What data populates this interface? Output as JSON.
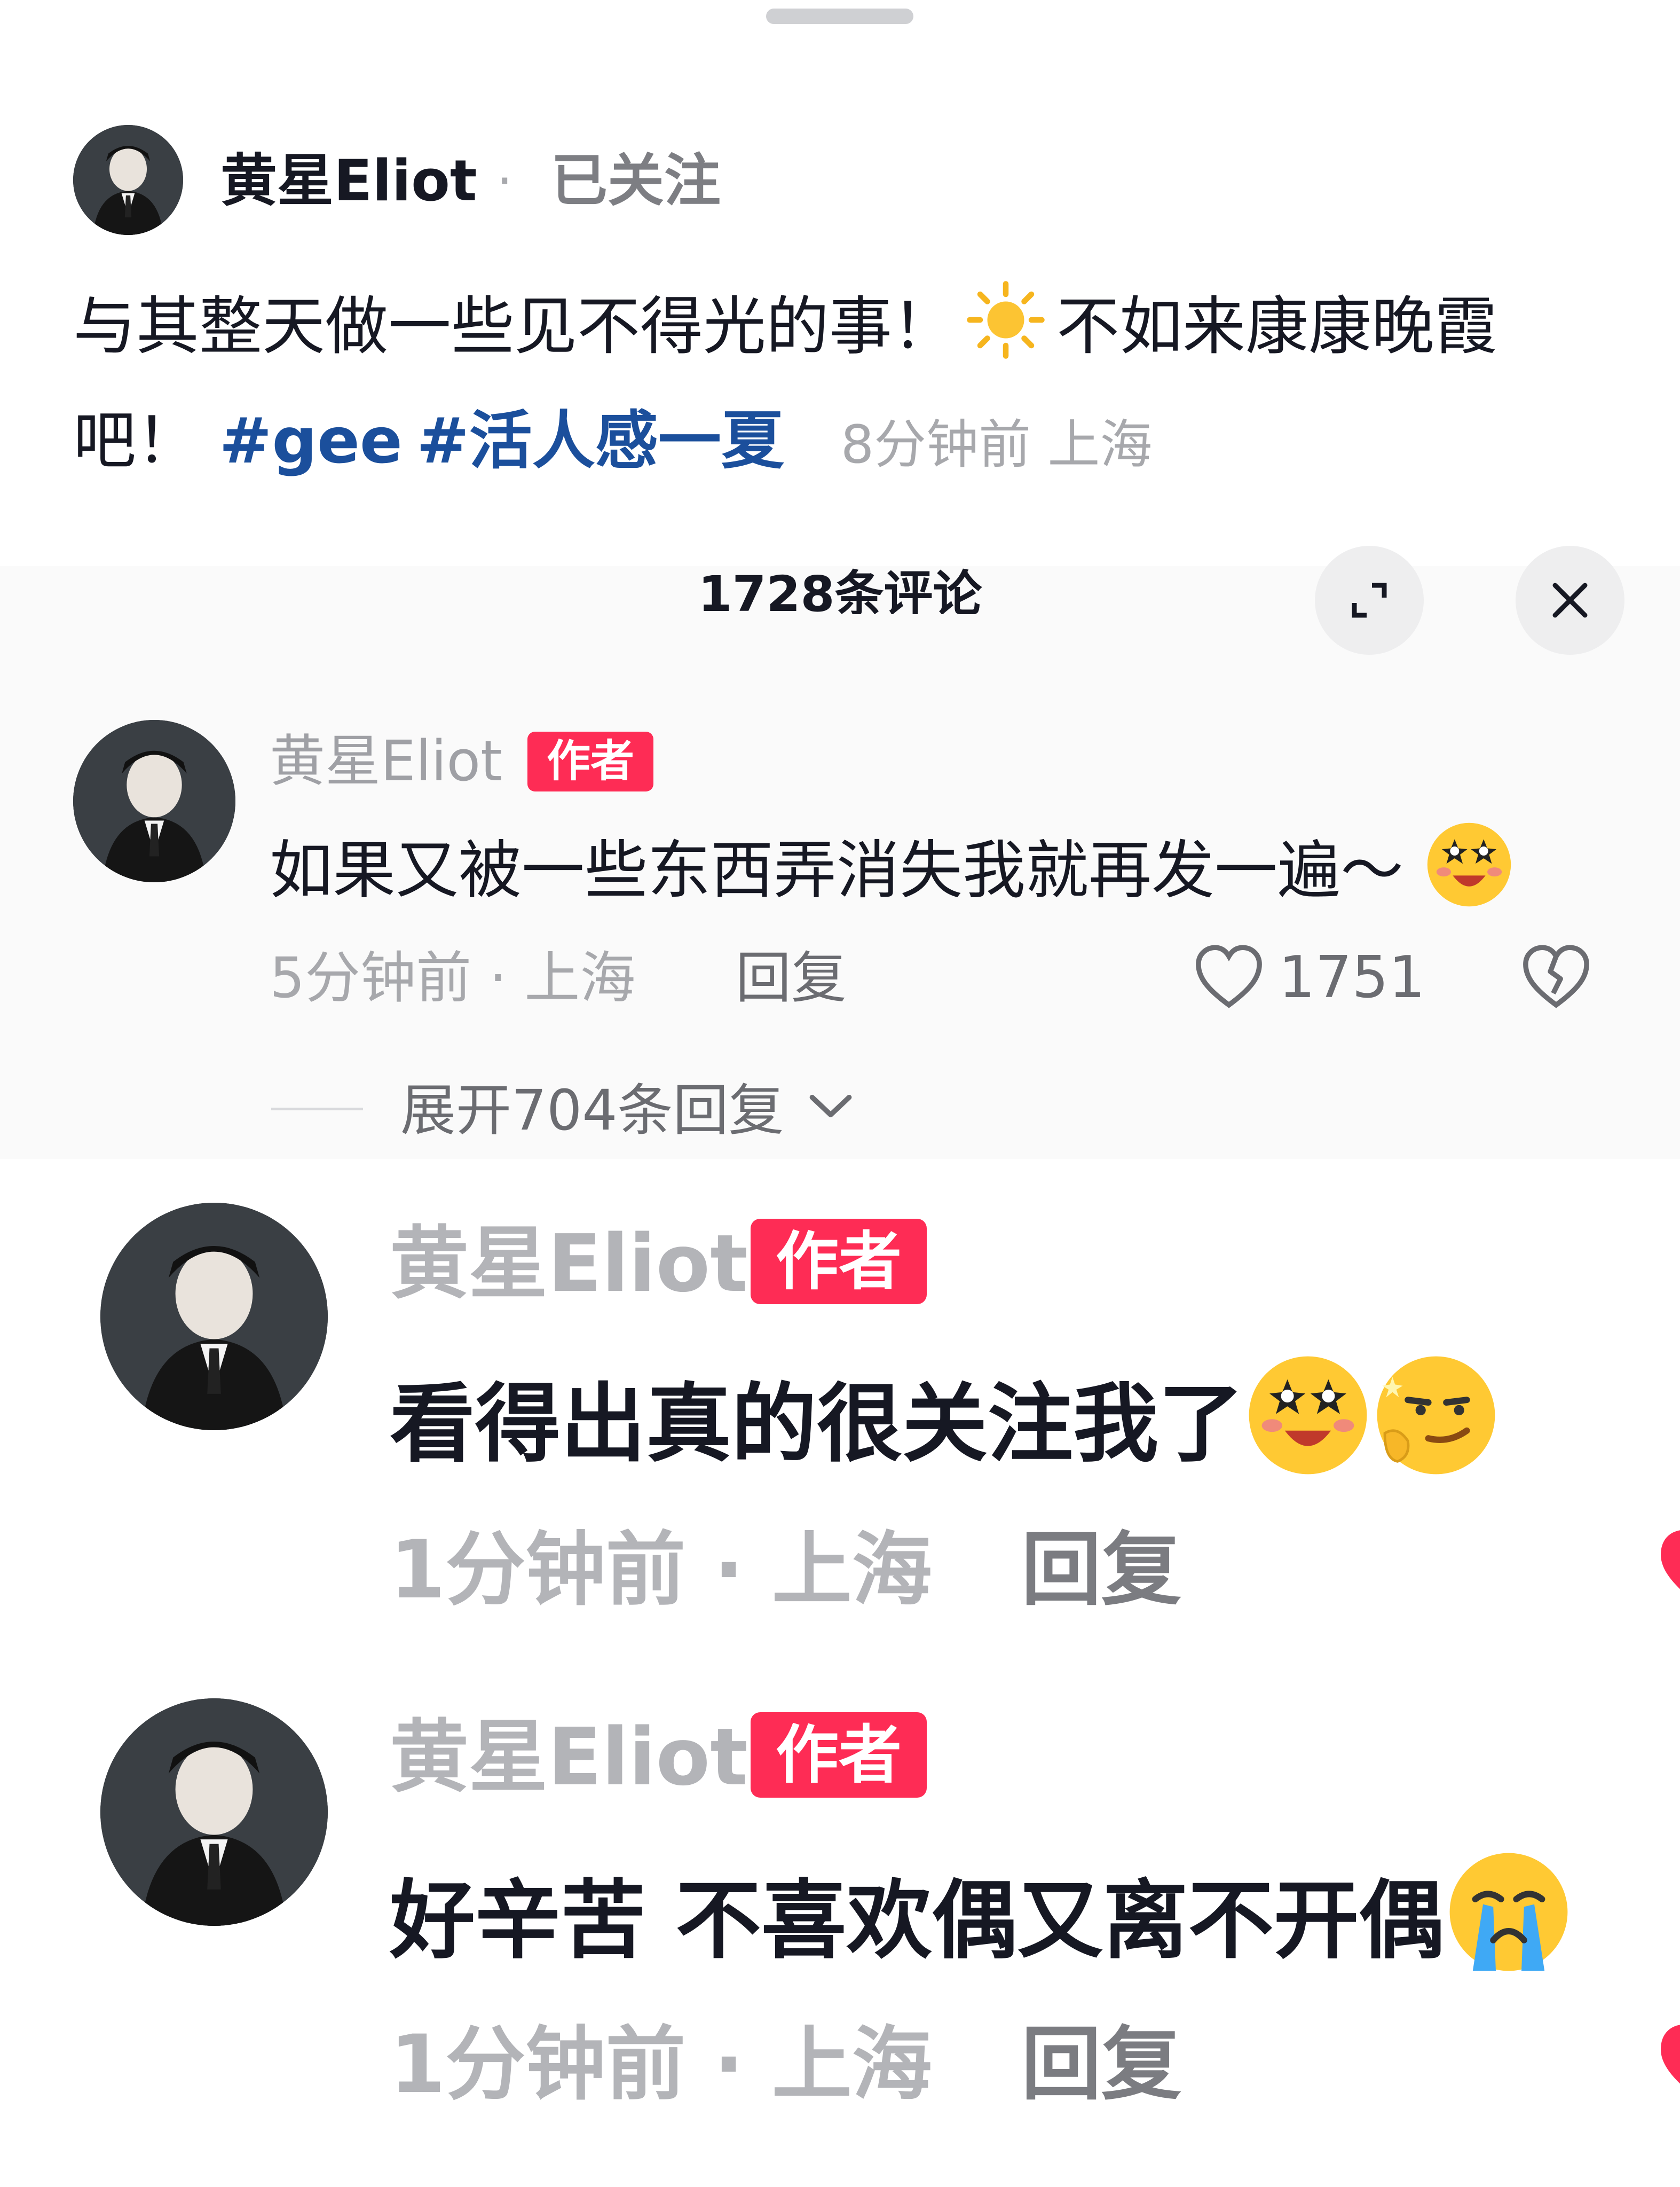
{
  "post": {
    "author": "黄星Eliot",
    "separator": "·",
    "follow_status": "已关注",
    "text_before_icon": "与其整天做一些见不得光的事！",
    "text_after_icon": "不如来康康晚霞吧！",
    "hashtags": [
      "#gee",
      "#活人感一夏"
    ],
    "meta": "8分钟前 上海"
  },
  "comments_panel": {
    "title": "1728条评论"
  },
  "top_comment": {
    "author": "黄星Eliot",
    "badge": "作者",
    "text": "如果又被一些东西弄消失我就再发一遍～",
    "meta": "5分钟前 · 上海",
    "reply_label": "回复",
    "like_count": "1751",
    "expand_label": "展开704条回复"
  },
  "replies": [
    {
      "author": "黄星Eliot",
      "badge": "作者",
      "text": "看得出真的很关注我了",
      "meta": "1分钟前 · 上海",
      "reply_label": "回复"
    },
    {
      "author": "黄星Eliot",
      "badge": "作者",
      "text": "好辛苦 不喜欢偶又离不开偶",
      "meta": "1分钟前 · 上海",
      "reply_label": "回复"
    }
  ],
  "colors": {
    "badge": "#fe2c55",
    "hashtag": "#1b4f9c",
    "like_heart": "#fe2c55"
  },
  "icons": [
    "sun-icon",
    "expand-icon",
    "close-icon",
    "heart-outline-icon",
    "broken-heart-icon",
    "chevron-down-icon",
    "starry-eyes-emoji",
    "smirk-emoji",
    "crying-emoji"
  ]
}
